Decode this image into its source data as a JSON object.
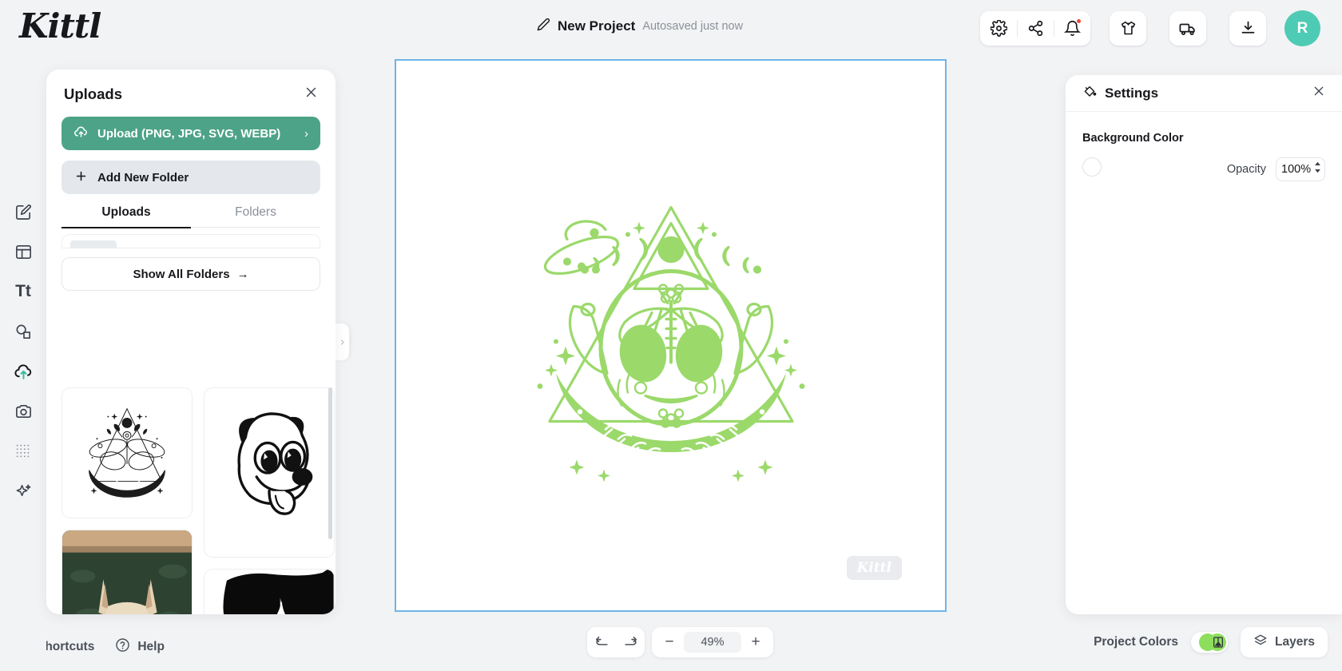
{
  "app": {
    "logo": "Kittl"
  },
  "header": {
    "project_name": "New Project",
    "autosave_status": "Autosaved just now",
    "edit_icon": "pencil-icon",
    "tools": [
      {
        "name": "settings-gear-icon"
      },
      {
        "name": "share-icon"
      },
      {
        "name": "notifications-bell-icon",
        "badge": true
      },
      {
        "name": "tshirt-merch-icon"
      },
      {
        "name": "shipping-truck-icon"
      },
      {
        "name": "download-icon"
      }
    ],
    "avatar_initial": "R"
  },
  "rail": {
    "items": [
      {
        "name": "design-edit-icon",
        "active": false
      },
      {
        "name": "templates-icon",
        "active": false
      },
      {
        "name": "text-icon",
        "active": false
      },
      {
        "name": "elements-shapes-icon",
        "active": false
      },
      {
        "name": "uploads-cloud-icon",
        "active": true
      },
      {
        "name": "photos-camera-icon",
        "active": false
      },
      {
        "name": "patterns-grid-icon",
        "active": false
      },
      {
        "name": "ai-sparkle-icon",
        "active": false
      }
    ]
  },
  "uploads_panel": {
    "title": "Uploads",
    "close_icon": "close-icon",
    "upload_button": {
      "label": "Upload (PNG, JPG, SVG, WEBP)",
      "icon": "cloud-upload-icon",
      "chevron": "›"
    },
    "add_folder_button": {
      "label": "Add New Folder",
      "icon": "plus-icon"
    },
    "tabs": [
      {
        "label": "Uploads",
        "active": true
      },
      {
        "label": "Folders",
        "active": false
      }
    ],
    "show_all_folders": {
      "label": "Show All Folders",
      "arrow": "→"
    },
    "thumbnails": [
      {
        "name": "mystic-butterfly-lineart-thumbnail"
      },
      {
        "name": "cartoon-dog-face-thumbnail"
      },
      {
        "name": "painted-dog-portrait-thumbnail"
      },
      {
        "name": "black-silhouette-thumbnail"
      }
    ],
    "collapse_handle_icon": "chevron-right-icon"
  },
  "canvas": {
    "artwork_name": "alien-butterfly-mystic-design",
    "artwork_color": "#9BD96B",
    "watermark": "Kittl",
    "selection_border_color": "#6eb4e8"
  },
  "settings_panel": {
    "title": "Settings",
    "icon": "paint-bucket-icon",
    "close_icon": "close-icon",
    "background_color_label": "Background Color",
    "swatch_color": "#ffffff",
    "opacity_label": "Opacity",
    "opacity_value": "100%"
  },
  "footer": {
    "shortcuts": {
      "label": "Shortcuts",
      "icon": "keyboard-icon"
    },
    "help": {
      "label": "Help",
      "icon": "question-circle-icon"
    },
    "undo_icon": "undo-arrow-icon",
    "redo_icon": "redo-arrow-icon",
    "zoom_out": "−",
    "zoom_level": "49%",
    "zoom_in": "+",
    "project_colors_label": "Project Colors",
    "project_colors_on": true,
    "layers": {
      "label": "Layers",
      "icon": "layers-icon"
    }
  }
}
